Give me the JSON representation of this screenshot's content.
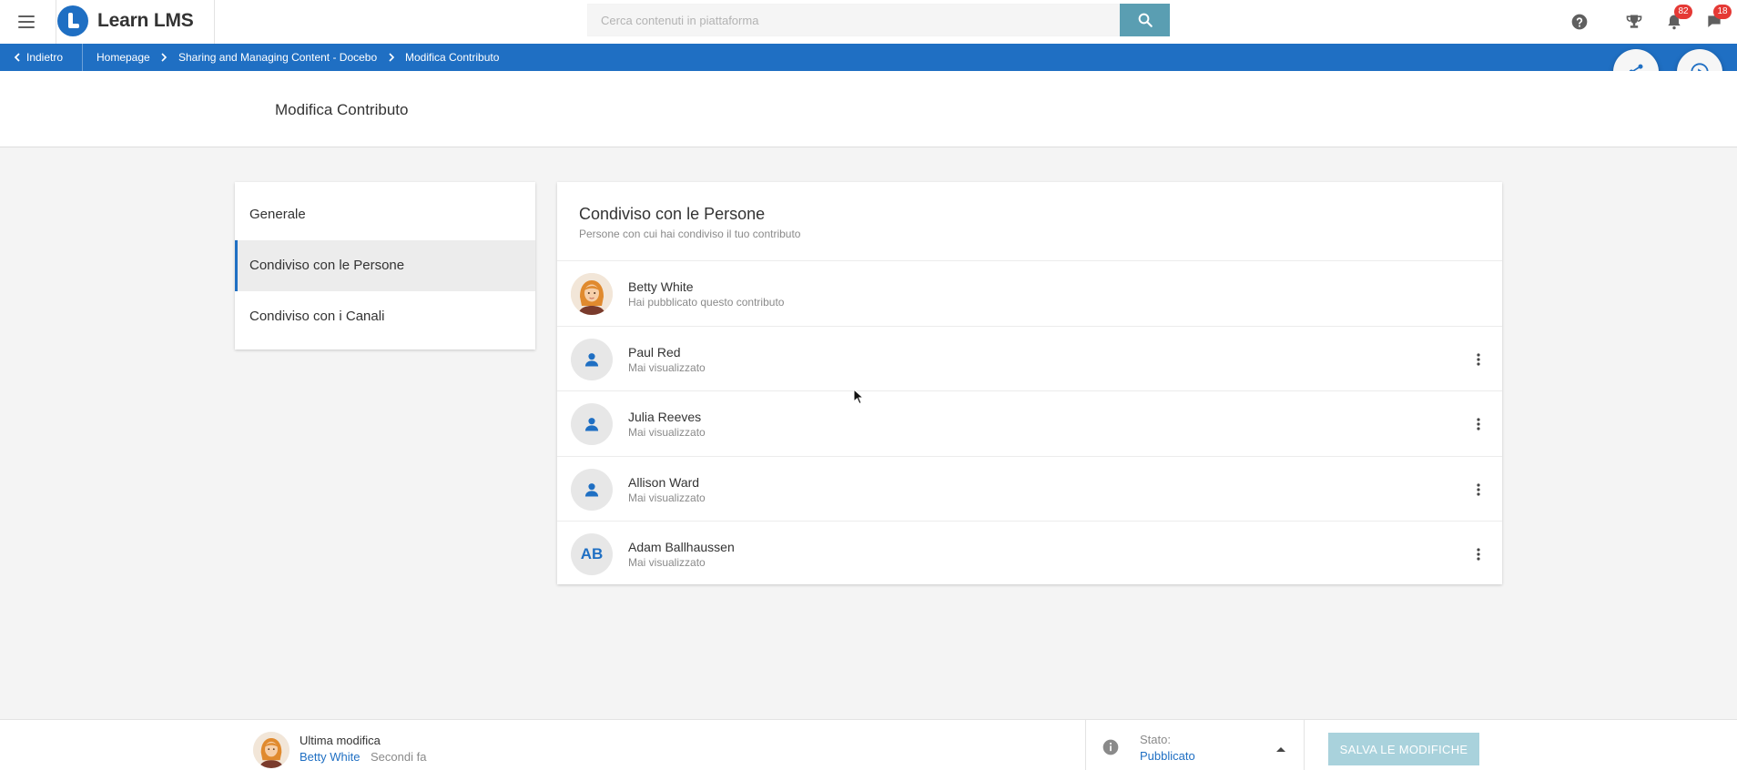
{
  "app": {
    "title": "Learn LMS",
    "search_placeholder": "Cerca contenuti in piattaforma",
    "notifications_count": "82",
    "messages_count": "18"
  },
  "breadcrumb": {
    "back_label": "Indietro",
    "items": [
      "Homepage",
      "Sharing and Managing Content - Docebo",
      "Modifica Contributo"
    ]
  },
  "page": {
    "title": "Modifica Contributo"
  },
  "menu": {
    "items": [
      {
        "label": "Generale",
        "active": false
      },
      {
        "label": "Condiviso con le Persone",
        "active": true
      },
      {
        "label": "Condiviso con i Canali",
        "active": false
      }
    ]
  },
  "people_panel": {
    "title": "Condiviso con le Persone",
    "subtitle": "Persone con cui hai condiviso il tuo contributo",
    "people": [
      {
        "name": "Betty White",
        "status": "Hai pubblicato questo contributo",
        "avatar": "photo"
      },
      {
        "name": "Paul Red",
        "status": "Mai visualizzato",
        "avatar": "person-icon"
      },
      {
        "name": "Julia Reeves",
        "status": "Mai visualizzato",
        "avatar": "person-icon"
      },
      {
        "name": "Allison Ward",
        "status": "Mai visualizzato",
        "avatar": "person-icon"
      },
      {
        "name": "Adam Ballhaussen",
        "status": "Mai visualizzato",
        "avatar": "initials",
        "initials": "AB"
      }
    ]
  },
  "footer": {
    "last_edit_label": "Ultima modifica",
    "last_edit_user": "Betty White",
    "last_edit_time": "Secondi fa",
    "state_label": "Stato:",
    "state_value": "Pubblicato",
    "save_label": "SALVA LE MODIFICHE"
  },
  "colors": {
    "brand_blue": "#1f6fc3",
    "search_button": "#5a9eb2",
    "save_button_disabled": "#a9d2dc",
    "badge_red": "#e53935"
  }
}
